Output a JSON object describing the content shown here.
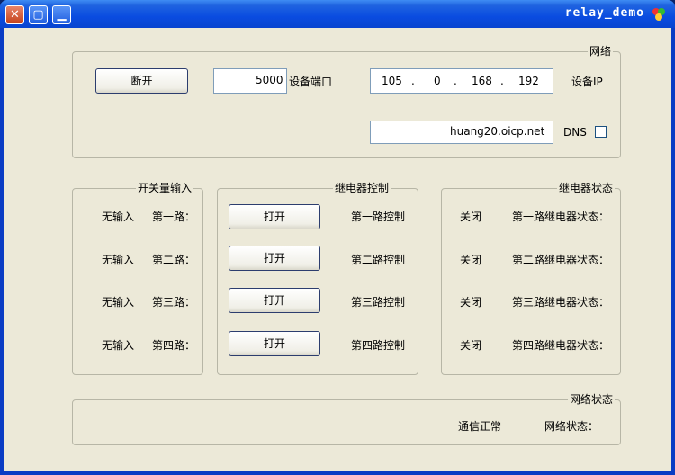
{
  "window": {
    "title": "relay_demo"
  },
  "network": {
    "group_title": "网络",
    "ip_label": "设备IP",
    "ip_octets": [
      "192",
      "168",
      "0",
      "105"
    ],
    "port_label": "设备端口",
    "port_value": "5000",
    "disconnect_label": "断开",
    "dns_label": "DNS",
    "dns_value": "huang20.oicp.net"
  },
  "relay_status": {
    "group_title": "继电器状态",
    "items": [
      {
        "label": "第一路继电器状态：",
        "value": "关闭"
      },
      {
        "label": "第二路继电器状态：",
        "value": "关闭"
      },
      {
        "label": "第三路继电器状态：",
        "value": "关闭"
      },
      {
        "label": "第四路继电器状态：",
        "value": "关闭"
      }
    ]
  },
  "relay_control": {
    "group_title": "继电器控制",
    "items": [
      {
        "label": "第一路控制",
        "button": "打开"
      },
      {
        "label": "第二路控制",
        "button": "打开"
      },
      {
        "label": "第三路控制",
        "button": "打开"
      },
      {
        "label": "第四路控制",
        "button": "打开"
      }
    ]
  },
  "switch_input": {
    "group_title": "开关量输入",
    "items": [
      {
        "label": "第一路：",
        "value": "无输入"
      },
      {
        "label": "第二路：",
        "value": "无输入"
      },
      {
        "label": "第三路：",
        "value": "无输入"
      },
      {
        "label": "第四路：",
        "value": "无输入"
      }
    ]
  },
  "network_status": {
    "group_title": "网络状态",
    "label": "网络状态：",
    "value": "通信正常"
  }
}
